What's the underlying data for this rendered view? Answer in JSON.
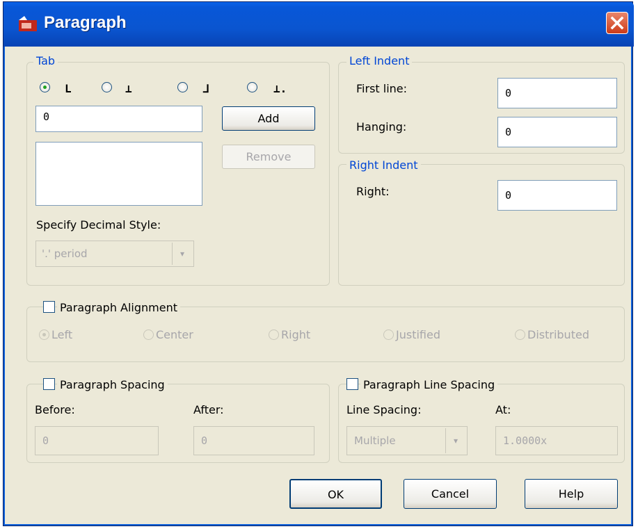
{
  "window": {
    "title": "Paragraph"
  },
  "tab_group": {
    "label": "Tab",
    "tab_types": [
      {
        "glyph": "L",
        "selected": true
      },
      {
        "glyph": "⊥",
        "selected": false
      },
      {
        "glyph": "⅃",
        "selected": false
      },
      {
        "glyph": "⊥.",
        "selected": false
      }
    ],
    "tab_input_value": "0",
    "add_label": "Add",
    "remove_label": "Remove",
    "decimal_label": "Specify Decimal Style:",
    "decimal_value": "'.' period"
  },
  "left_indent": {
    "label": "Left Indent",
    "first_line_label": "First line:",
    "first_line_value": "0",
    "hanging_label": "Hanging:",
    "hanging_value": "0"
  },
  "right_indent": {
    "label": "Right Indent",
    "right_label": "Right:",
    "right_value": "0"
  },
  "alignment": {
    "label": "Paragraph Alignment",
    "checked": false,
    "options": [
      "Left",
      "Center",
      "Right",
      "Justified",
      "Distributed"
    ],
    "selected": "Left"
  },
  "spacing": {
    "label": "Paragraph Spacing",
    "checked": false,
    "before_label": "Before:",
    "before_value": "0",
    "after_label": "After:",
    "after_value": "0"
  },
  "line_spacing": {
    "label": "Paragraph Line Spacing",
    "checked": false,
    "line_spacing_label": "Line Spacing:",
    "line_spacing_value": "Multiple",
    "at_label": "At:",
    "at_value": "1.0000x"
  },
  "buttons": {
    "ok": "OK",
    "cancel": "Cancel",
    "help": "Help"
  },
  "colors": {
    "title_bar": "#0a55d0",
    "group_label": "#0046d5",
    "dialog_bg": "#ece9d8"
  }
}
